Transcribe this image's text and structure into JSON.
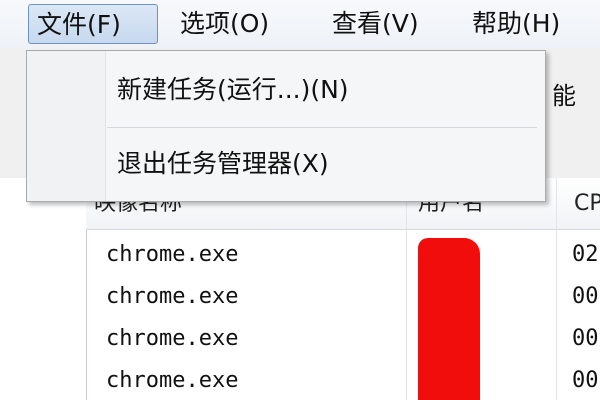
{
  "menubar": {
    "items": [
      {
        "label": "文件(F)"
      },
      {
        "label": "选项(O)"
      },
      {
        "label": "查看(V)"
      },
      {
        "label": "帮助(H)"
      }
    ]
  },
  "file_menu": {
    "items": [
      {
        "label": "新建任务(运行...)(N)"
      },
      {
        "label": "退出任务管理器(X)"
      }
    ]
  },
  "tabs": {
    "partial_label": "能"
  },
  "process_list": {
    "columns": [
      {
        "label": "映像名称"
      },
      {
        "label": "用户名"
      },
      {
        "label": "CPU"
      }
    ],
    "rows": [
      {
        "name": "chrome.exe",
        "cpu": "02"
      },
      {
        "name": "chrome.exe",
        "cpu": "00"
      },
      {
        "name": "chrome.exe",
        "cpu": "00"
      },
      {
        "name": "chrome.exe",
        "cpu": "00"
      }
    ]
  },
  "colors": {
    "redaction": "#f20d0d",
    "menu_highlight_border": "#6f93bd"
  }
}
